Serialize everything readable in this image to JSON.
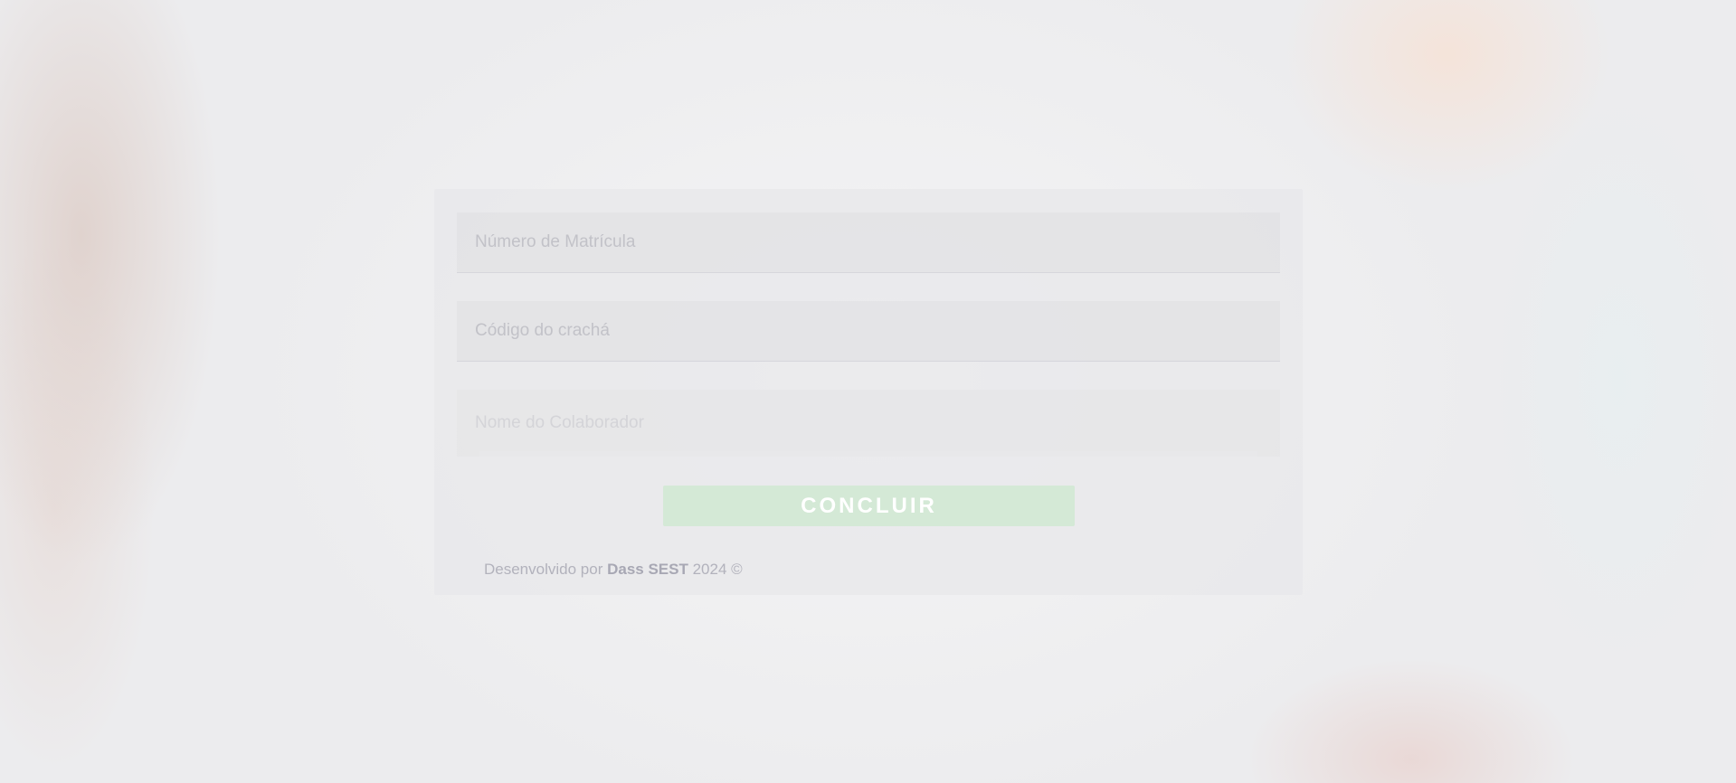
{
  "form": {
    "matricula_placeholder": "Número de Matrícula",
    "matricula_value": "",
    "cracha_placeholder": "Código do crachá",
    "cracha_value": "",
    "colaborador_placeholder": "Nome do Colaborador",
    "colaborador_value": "",
    "submit_label": "CONCLUIR"
  },
  "footer": {
    "prefix": "Desenvolvido por",
    "brand": "Dass SEST",
    "suffix": "2024 ©"
  },
  "colors": {
    "submit_button": "#d4e9d6",
    "card_background": "#e8e8ea"
  }
}
